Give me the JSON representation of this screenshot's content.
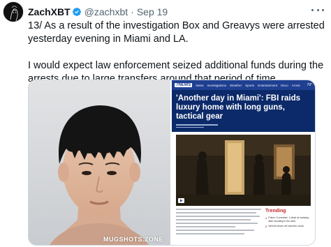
{
  "tweet": {
    "display_name": "ZachXBT",
    "handle": "@zachxbt",
    "separator": "·",
    "date": "Sep 19",
    "verified_icon": "verified-badge-icon",
    "more_icon": "more-options-icon",
    "paragraphs": [
      "13/ As a result of the investigation Box and Greavys were arrested yesterday evening in Miami and LA.",
      "I would expect law enforcement seized additional funds during the arrests due to large transfers around that period of time."
    ]
  },
  "media": {
    "mugshot_watermark": "MUGSHOTS.ZONE",
    "article": {
      "logo": "7NEWS",
      "nav_items": [
        "News",
        "Investigations",
        "Weather",
        "Sports",
        "Entertainment",
        "Deco",
        "Arrest"
      ],
      "weather": "79°",
      "headline": "'Another day in Miami': FBI raids luxury home with long guns, tactical gear",
      "trending_title": "Trending",
      "trending_items": [
        "Police: 5 arrested, 1 dead at roadway after shooting in the area",
        "Vehicle drives off road into canal"
      ]
    }
  },
  "colors": {
    "verified": "#1d9bf0",
    "secondary_text": "#536471",
    "news_bar": "#1f3f91",
    "news_head": "#0c2a69",
    "trending": "#c1272d"
  }
}
